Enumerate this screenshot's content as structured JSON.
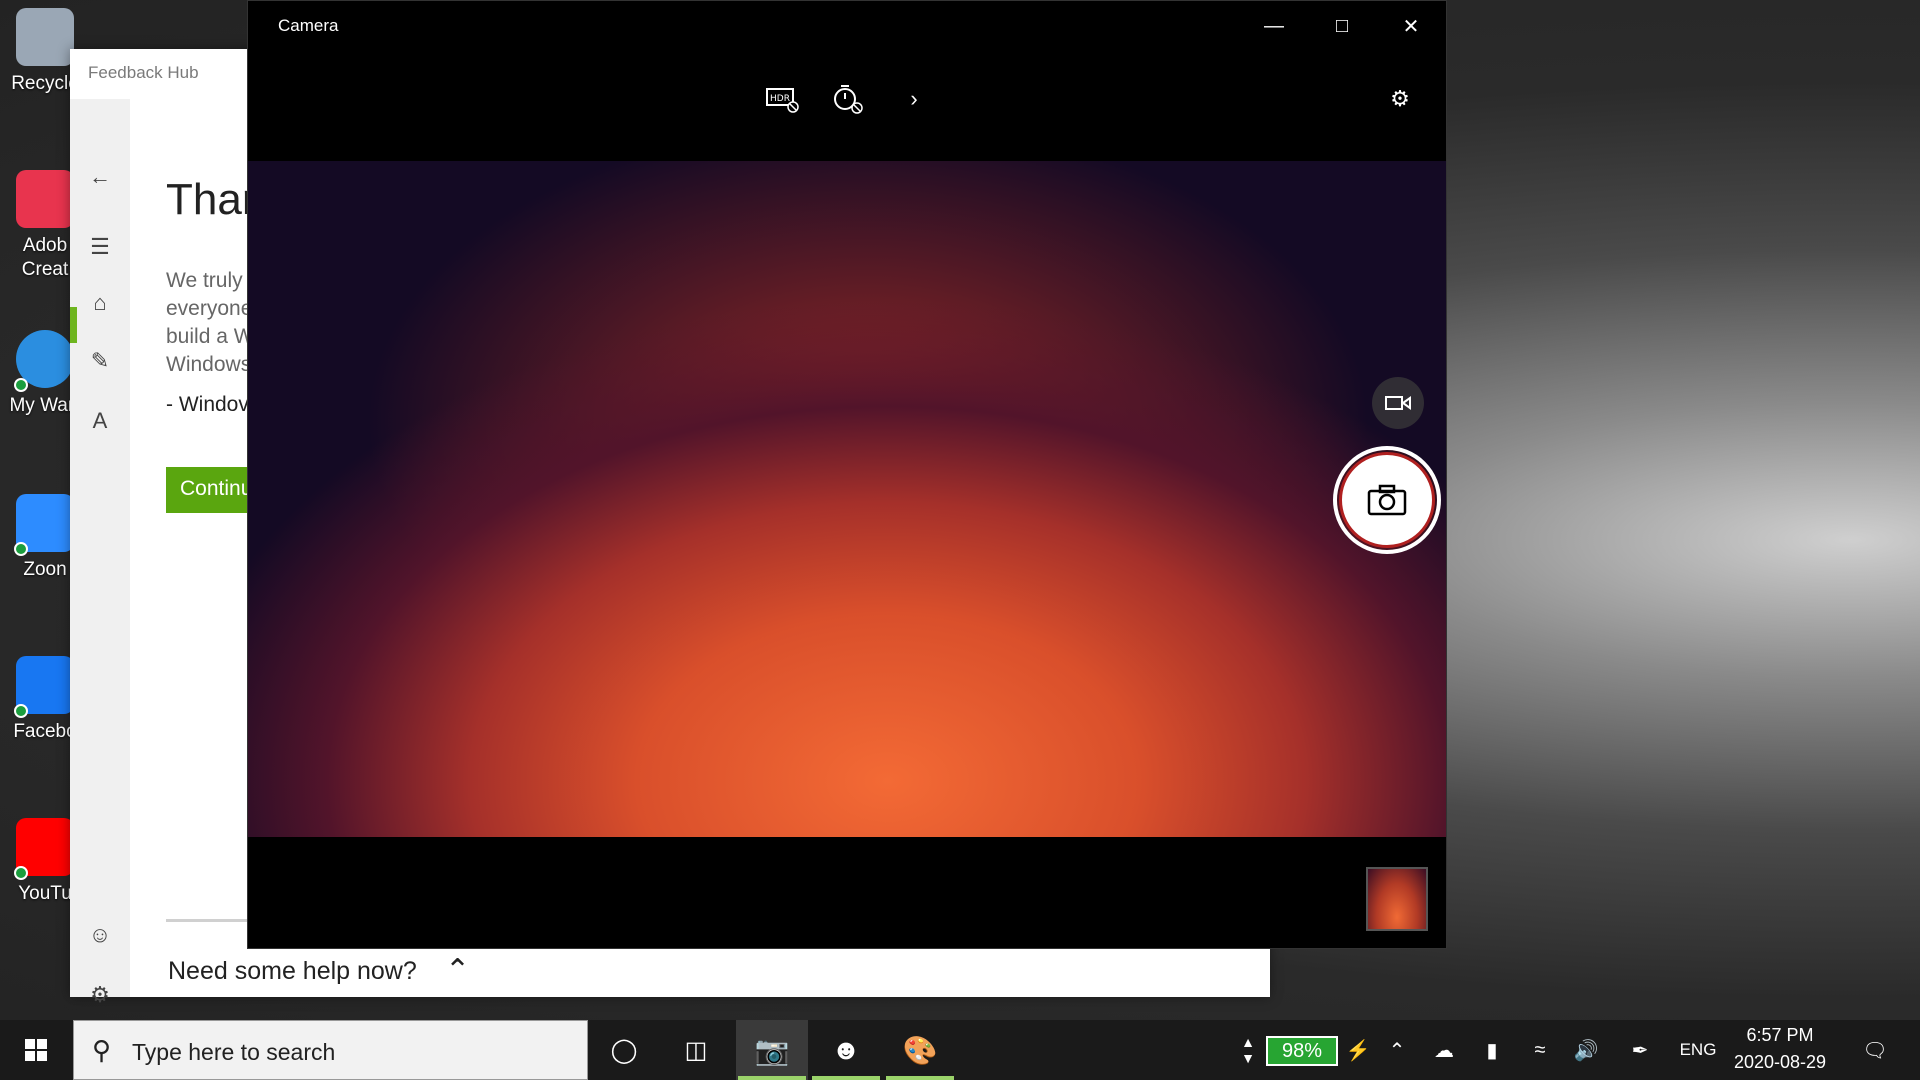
{
  "desktop": {
    "icons": [
      {
        "label": "Recycle",
        "color": "#9aa7b5"
      },
      {
        "label": "Adob Creat",
        "color": "#e8344e"
      },
      {
        "label": "My Warr",
        "color": "#2b8ee0"
      },
      {
        "label": "Zoon",
        "color": "#2d8cff"
      },
      {
        "label": "Facebo",
        "color": "#1877f2"
      },
      {
        "label": "YouTu",
        "color": "#ff0000"
      }
    ]
  },
  "feedback_hub": {
    "title": "Feedback Hub",
    "heading": "Than",
    "body": "We truly everyone build a W Windows",
    "signature": "- Windov",
    "continue_label": "Continu",
    "help_text": "Need some help now?",
    "accent": "#6eb51f"
  },
  "camera": {
    "title": "Camera",
    "tools": [
      "hdr-off-icon",
      "timer-off-icon",
      "chevron-right-icon"
    ]
  },
  "taskbar": {
    "search_placeholder": "Type here to search",
    "battery": "98%",
    "language": "ENG",
    "time": "6:57 PM",
    "date": "2020-08-29"
  }
}
